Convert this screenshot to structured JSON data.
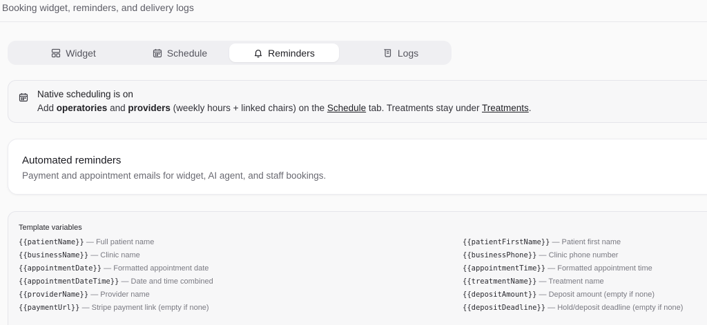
{
  "subtitle": "Booking widget, reminders, and delivery logs",
  "tabs": [
    {
      "label": "Widget",
      "icon": "layout-icon",
      "active": false
    },
    {
      "label": "Schedule",
      "icon": "calendar-icon",
      "active": false
    },
    {
      "label": "Reminders",
      "icon": "bell-icon",
      "active": true
    },
    {
      "label": "Logs",
      "icon": "scroll-icon",
      "active": false
    }
  ],
  "notice": {
    "title": "Native scheduling is on",
    "pre": "Add ",
    "bold1": "operatories",
    "mid1": " and ",
    "bold2": "providers",
    "mid2": " (weekly hours + linked chairs) on the ",
    "link1": "Schedule",
    "mid3": " tab. Treatments stay under ",
    "link2": "Treatments",
    "end": "."
  },
  "reminders_card": {
    "title": "Automated reminders",
    "description": "Payment and appointment emails for widget, AI agent, and staff bookings."
  },
  "template_variables": {
    "heading": "Template variables",
    "left": [
      {
        "code": "{{patientName}}",
        "desc": " — Full patient name"
      },
      {
        "code": "{{businessName}}",
        "desc": " — Clinic name"
      },
      {
        "code": "{{appointmentDate}}",
        "desc": " — Formatted appointment date"
      },
      {
        "code": "{{appointmentDateTime}}",
        "desc": " — Date and time combined"
      },
      {
        "code": "{{providerName}}",
        "desc": " — Provider name"
      },
      {
        "code": "{{paymentUrl}}",
        "desc": " — Stripe payment link (empty if none)"
      }
    ],
    "right": [
      {
        "code": "{{patientFirstName}}",
        "desc": " — Patient first name"
      },
      {
        "code": "{{businessPhone}}",
        "desc": " — Clinic phone number"
      },
      {
        "code": "{{appointmentTime}}",
        "desc": " — Formatted appointment time"
      },
      {
        "code": "{{treatmentName}}",
        "desc": " — Treatment name"
      },
      {
        "code": "{{depositAmount}}",
        "desc": " — Deposit amount (empty if none)"
      },
      {
        "code": "{{depositDeadline}}",
        "desc": " — Hold/deposit deadline (empty if none)"
      }
    ]
  }
}
